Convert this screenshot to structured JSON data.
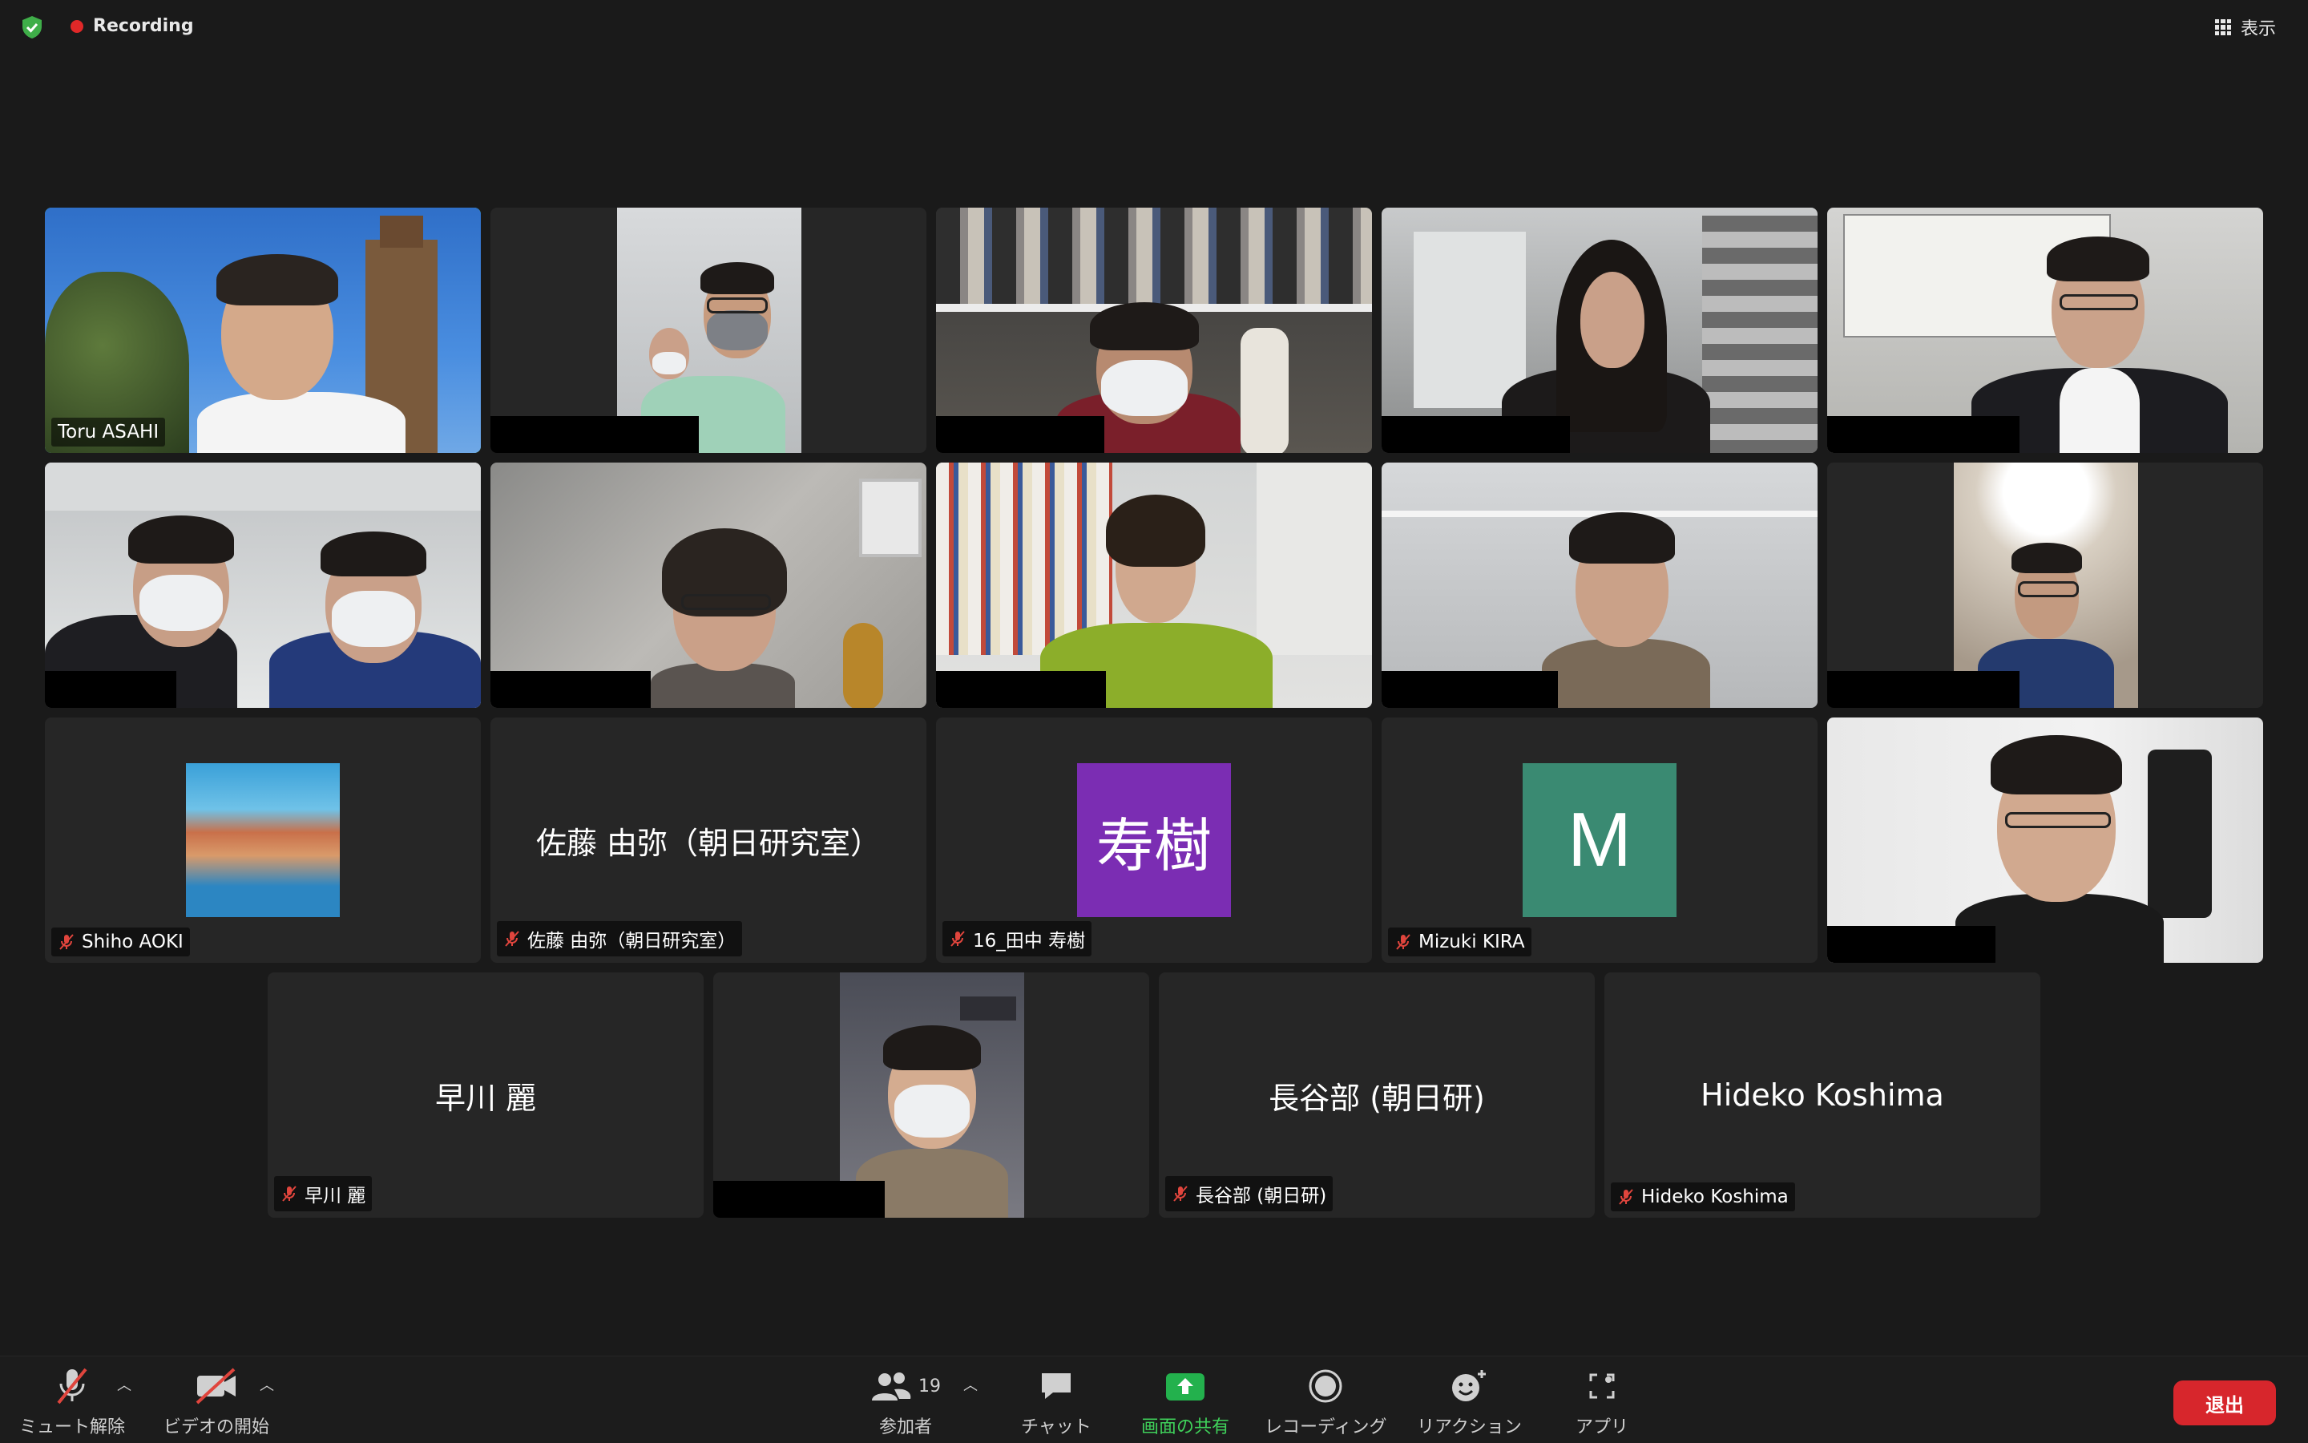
{
  "top": {
    "recording_label": "Recording",
    "view_label": "表示"
  },
  "tiles": {
    "t1": {
      "name": "Toru ASAHI"
    },
    "t11": {
      "name": "Shiho AOKI"
    },
    "t12": {
      "center": "佐藤 由弥（朝日研究室）",
      "name": "佐藤 由弥（朝日研究室）"
    },
    "t13": {
      "avatar": "寿樹",
      "name": "16_田中 寿樹",
      "avatar_color": "#7b2db3"
    },
    "t14": {
      "avatar": "M",
      "name": "Mizuki KIRA",
      "avatar_color": "#3a8a72"
    },
    "t16": {
      "center": "早川 麗",
      "name": "早川 麗"
    },
    "t18": {
      "center": "長谷部 (朝日研)",
      "name": "長谷部 (朝日研)"
    },
    "t19": {
      "center": "Hideko Koshima",
      "name": "Hideko Koshima"
    }
  },
  "toolbar": {
    "mute_label": "ミュート解除",
    "video_label": "ビデオの開始",
    "participants_label": "参加者",
    "participants_count": "19",
    "chat_label": "チャット",
    "share_label": "画面の共有",
    "record_label": "レコーディング",
    "reaction_label": "リアクション",
    "apps_label": "アプリ",
    "leave_label": "退出"
  },
  "colors": {
    "active_speaker": "#3fd15a",
    "share_green": "#23b14d",
    "leave_red": "#d7262c",
    "mute_red": "#e0453d"
  }
}
